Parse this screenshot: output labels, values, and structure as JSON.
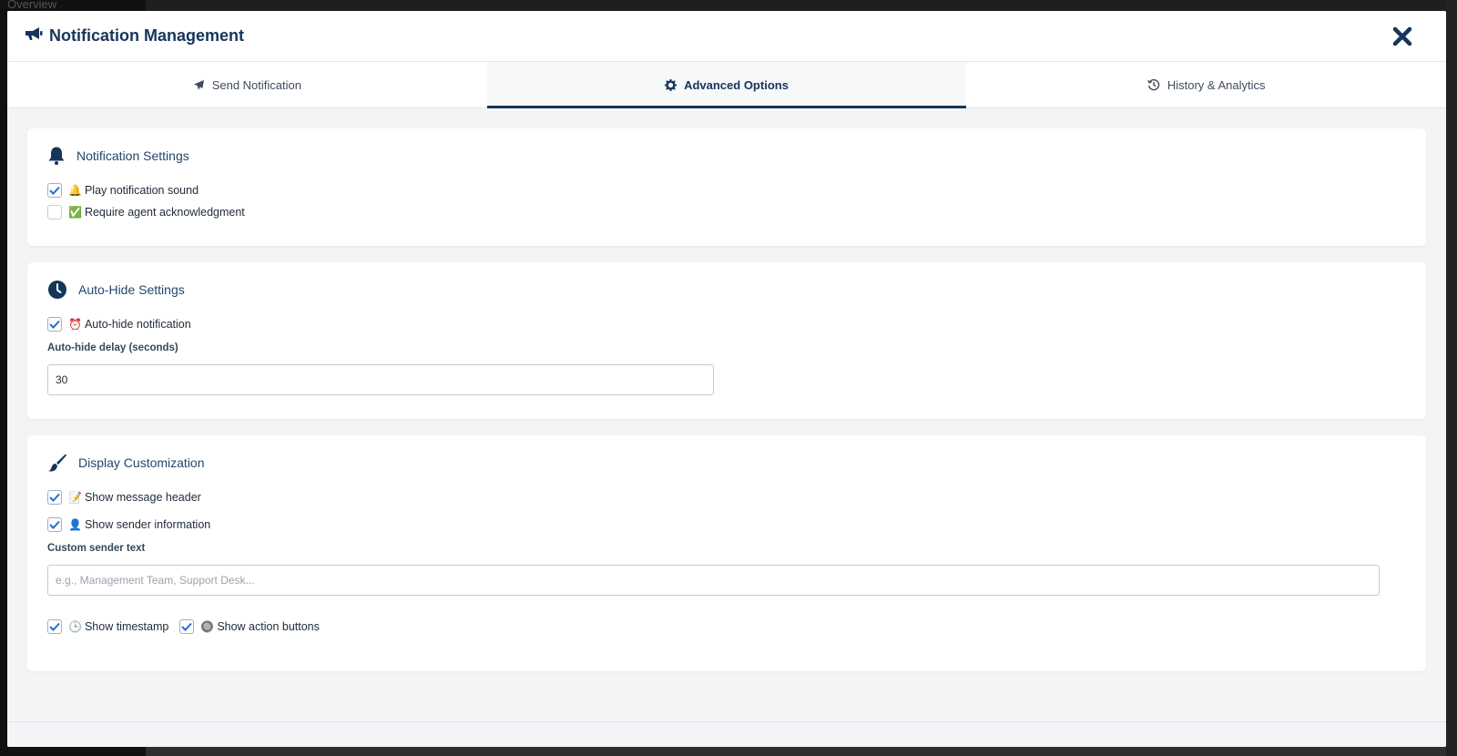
{
  "background": {
    "overview_label": "Overview"
  },
  "modal": {
    "title": "Notification Management",
    "close_icon": "close-icon"
  },
  "tabs": [
    {
      "label": "Send Notification",
      "icon": "paper-plane-icon",
      "active": false
    },
    {
      "label": "Advanced Options",
      "icon": "gear-icon",
      "active": true
    },
    {
      "label": "History & Analytics",
      "icon": "history-icon",
      "active": false
    }
  ],
  "notification_settings": {
    "title": "Notification Settings",
    "icon": "bell-icon",
    "options": [
      {
        "emoji": "🔔",
        "label": "Play notification sound",
        "checked": true
      },
      {
        "emoji": "✅",
        "label": "Require agent acknowledgment",
        "checked": false
      }
    ]
  },
  "auto_hide_settings": {
    "title": "Auto-Hide Settings",
    "icon": "clock-icon",
    "option": {
      "emoji": "⏰",
      "label": "Auto-hide notification",
      "checked": true
    },
    "delay_label": "Auto-hide delay (seconds)",
    "delay_value": "30"
  },
  "display_customization": {
    "title": "Display Customization",
    "icon": "paint-brush-icon",
    "options": [
      {
        "emoji": "📝",
        "label": "Show message header",
        "checked": true
      },
      {
        "emoji": "👤",
        "label": "Show sender information",
        "checked": true
      }
    ],
    "sender_label": "Custom sender text",
    "sender_placeholder": "e.g., Management Team, Support Desk...",
    "sender_value": "",
    "inline_options": [
      {
        "emoji": "🕒",
        "label": "Show timestamp",
        "checked": true
      },
      {
        "emoji": "🔘",
        "label": "Show action buttons",
        "checked": true
      }
    ]
  },
  "colors": {
    "primary": "#17345a",
    "checkbox_check": "#1f6fd1",
    "card_bg": "#ffffff",
    "modal_bg": "#f3f4f6"
  }
}
